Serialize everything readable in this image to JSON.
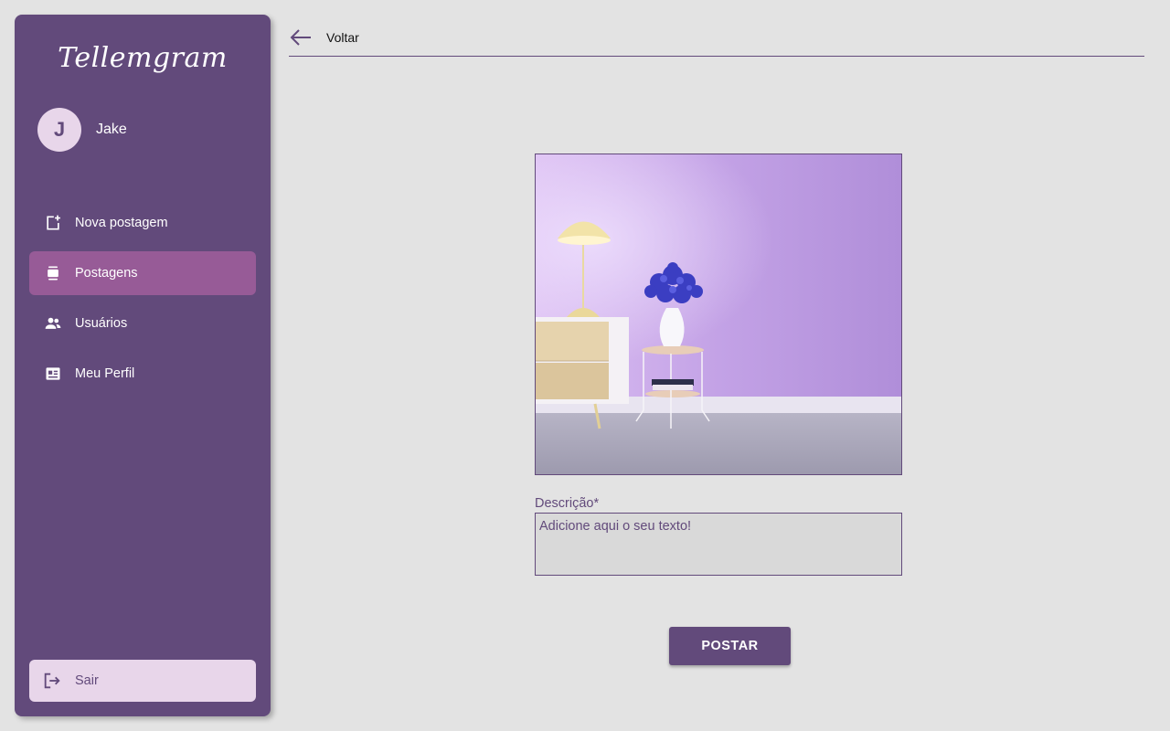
{
  "app": {
    "logo": "Tellemgram"
  },
  "user": {
    "initial": "J",
    "name": "Jake"
  },
  "nav": {
    "items": [
      {
        "label": "Nova postagem",
        "icon": "add-post-icon",
        "active": false
      },
      {
        "label": "Postagens",
        "icon": "posts-icon",
        "active": true
      },
      {
        "label": "Usuários",
        "icon": "users-icon",
        "active": false
      },
      {
        "label": "Meu Perfil",
        "icon": "profile-card-icon",
        "active": false
      }
    ],
    "logout_label": "Sair"
  },
  "topbar": {
    "back_label": "Voltar"
  },
  "form": {
    "description_label": "Descrição*",
    "description_placeholder": "Adicione aqui o seu texto!",
    "description_value": "",
    "submit_label": "POSTAR"
  },
  "colors": {
    "primary": "#624a7b",
    "active_nav": "#975b97",
    "light_accent": "#e8d6ea",
    "background": "#e3e3e3",
    "input_bg": "#d9d9d9"
  }
}
